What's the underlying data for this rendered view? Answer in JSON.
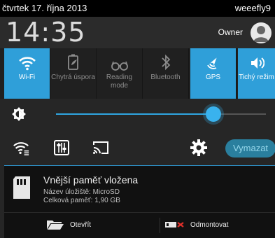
{
  "status_bar": {
    "date": "čtvrtek 17. října 2013",
    "user": "weeefly9"
  },
  "header": {
    "time": "14:35",
    "owner": "Owner"
  },
  "toggles": [
    {
      "label": "Wi-Fi",
      "icon": "wifi-icon",
      "on": true
    },
    {
      "label": "Chytrá úspora",
      "icon": "battery-saver-icon",
      "on": false
    },
    {
      "label": "Reading mode",
      "icon": "reading-glasses-icon",
      "on": false
    },
    {
      "label": "Bluetooth",
      "icon": "bluetooth-icon",
      "on": false
    },
    {
      "label": "GPS",
      "icon": "gps-icon",
      "on": true
    },
    {
      "label": "Tichý režim",
      "icon": "sound-icon",
      "on": true
    }
  ],
  "brightness": {
    "level": 0.75
  },
  "actions": {
    "clear_label": "Vymazat"
  },
  "notification": {
    "title": "Vnější paměť vložena",
    "storage_name": "Název úložiště: MicroSD",
    "total_memory": "Celková paměť: 1,90 GB",
    "open_label": "Otevřít",
    "unmount_label": "Odmontovat"
  },
  "colors": {
    "accent": "#2f9fd9",
    "slider": "#39b2ee"
  }
}
